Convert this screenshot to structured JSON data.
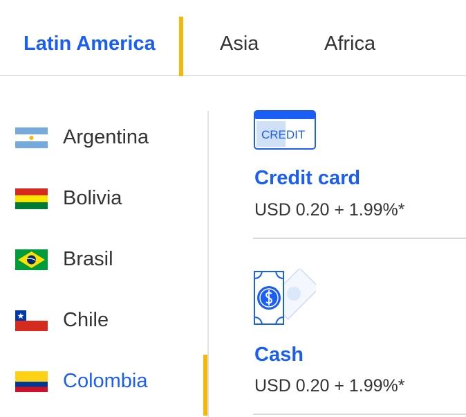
{
  "tabs": [
    {
      "label": "Latin America",
      "active": true
    },
    {
      "label": "Asia",
      "active": false
    },
    {
      "label": "Africa",
      "active": false
    }
  ],
  "countries": [
    {
      "name": "Argentina",
      "flag": "argentina-flag-icon"
    },
    {
      "name": "Bolivia",
      "flag": "bolivia-flag-icon"
    },
    {
      "name": "Brasil",
      "flag": "brazil-flag-icon"
    },
    {
      "name": "Chile",
      "flag": "chile-flag-icon"
    },
    {
      "name": "Colombia",
      "flag": "colombia-flag-icon",
      "active": true
    }
  ],
  "payment_methods": [
    {
      "title": "Credit card",
      "fee": "USD 0.20 + 1.99%*",
      "icon": "credit-card-icon",
      "icon_text": "CREDIT"
    },
    {
      "title": "Cash",
      "fee": "USD 0.20 + 1.99%*",
      "icon": "cash-icon"
    }
  ],
  "colors": {
    "accent": "#1b5ef5",
    "highlight": "#f2b90c",
    "text": "#333333",
    "divider": "#e2e2e2"
  }
}
